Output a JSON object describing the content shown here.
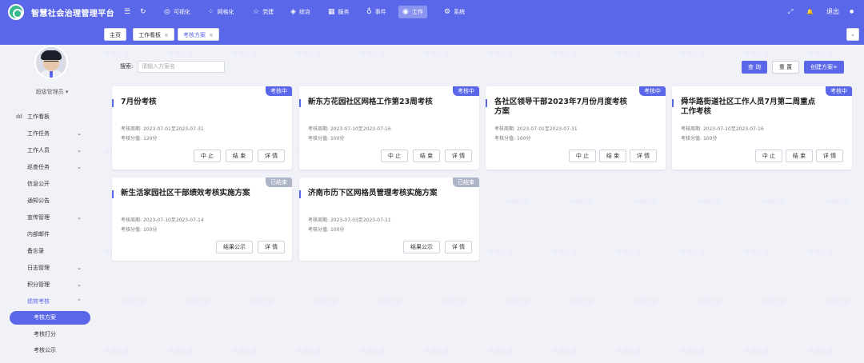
{
  "app": {
    "title": "智慧社会治理管理平台"
  },
  "topbar": {
    "nav": [
      {
        "label": "可视化",
        "icon": "dashboard-icon",
        "glyph": "◎"
      },
      {
        "label": "网格化",
        "icon": "grid-icon",
        "glyph": "⁘"
      },
      {
        "label": "党建",
        "icon": "star-icon",
        "glyph": "☆"
      },
      {
        "label": "综治",
        "icon": "shield-icon",
        "glyph": "◈"
      },
      {
        "label": "服务",
        "icon": "service-icon",
        "glyph": "▦"
      },
      {
        "label": "事件",
        "icon": "location-icon",
        "glyph": "♁"
      },
      {
        "label": "工作",
        "icon": "work-icon",
        "glyph": "◉"
      },
      {
        "label": "系统",
        "icon": "settings-icon",
        "glyph": "⚙"
      }
    ],
    "logout": "退出",
    "menu_glyph": "☰",
    "refresh_glyph": "↻",
    "fullscreen_glyph": "⤢",
    "bell_glyph": "🔔",
    "user_glyph": "●"
  },
  "sidebar": {
    "user": "超级管理员 ▾",
    "items": [
      {
        "label": "工作看板",
        "glyph": "ılıl"
      },
      {
        "label": "工作任务",
        "chevron": "⌄"
      },
      {
        "label": "工作人员",
        "chevron": "⌄"
      },
      {
        "label": "巡查任务",
        "chevron": "⌄"
      },
      {
        "label": "信息公开"
      },
      {
        "label": "通知公告"
      },
      {
        "label": "宣传管理",
        "chevron": "⌄"
      },
      {
        "label": "内部邮件"
      },
      {
        "label": "备忘录"
      },
      {
        "label": "日志管理",
        "chevron": "⌄"
      },
      {
        "label": "积分管理",
        "chevron": "⌄"
      },
      {
        "label": "绩效考核",
        "chevron": "⌃"
      },
      {
        "label": "考核方案"
      },
      {
        "label": "考核打分"
      },
      {
        "label": "考核公示"
      }
    ]
  },
  "tabs": [
    {
      "label": "主页"
    },
    {
      "label": "工作看板",
      "close": "×"
    },
    {
      "label": "考核方案",
      "close": "×"
    }
  ],
  "tabs_dropdown": "⌄",
  "search": {
    "label": "搜索:",
    "placeholder": "请输入方案名"
  },
  "buttons": {
    "query": "查 询",
    "reset": "重 置",
    "create": "创建方案+"
  },
  "cards": [
    {
      "status": "考核中",
      "title": "7月份考核",
      "period_label": "考核周期:",
      "period": "2023-07-01至2023-07-31",
      "score_label": "考核分值:",
      "score": "120分",
      "actions": [
        "中 止",
        "结 束",
        "详 情"
      ]
    },
    {
      "status": "考核中",
      "title": "新东方花园社区网格工作第23周考核",
      "period_label": "考核周期:",
      "period": "2023-07-10至2023-07-16",
      "score_label": "考核分值:",
      "score": "100分",
      "actions": [
        "中 止",
        "结 束",
        "详 情"
      ]
    },
    {
      "status": "考核中",
      "title": "各社区领导干部2023年7月份月度考核方案",
      "period_label": "考核周期:",
      "period": "2023-07-01至2023-07-31",
      "score_label": "考核分值:",
      "score": "100分",
      "actions": [
        "中 止",
        "结 束",
        "详 情"
      ]
    },
    {
      "status": "考核中",
      "title": "舜华路街道社区工作人员7月第二周重点工作考核",
      "period_label": "考核周期:",
      "period": "2023-07-10至2023-07-16",
      "score_label": "考核分值:",
      "score": "100分",
      "actions": [
        "中 止",
        "结 束",
        "详 情"
      ]
    },
    {
      "status": "已结束",
      "title": "新生活家园社区干部绩效考核实施方案",
      "period_label": "考核周期:",
      "period": "2023-07-10至2023-07-14",
      "score_label": "考核分值:",
      "score": "100分",
      "actions": [
        "结果公示",
        "详 情"
      ]
    },
    {
      "status": "已结束",
      "title": "济南市历下区网格员管理考核实施方案",
      "period_label": "考核周期:",
      "period": "2023-07-03至2023-07-11",
      "score_label": "考核分值:",
      "score": "100分",
      "actions": [
        "结果公示",
        "详 情"
      ]
    }
  ],
  "watermark": "齐普信息",
  "colors": {
    "brand": "#5a67e8",
    "ended": "#aeb4c8",
    "background": "#f1f2f8"
  }
}
